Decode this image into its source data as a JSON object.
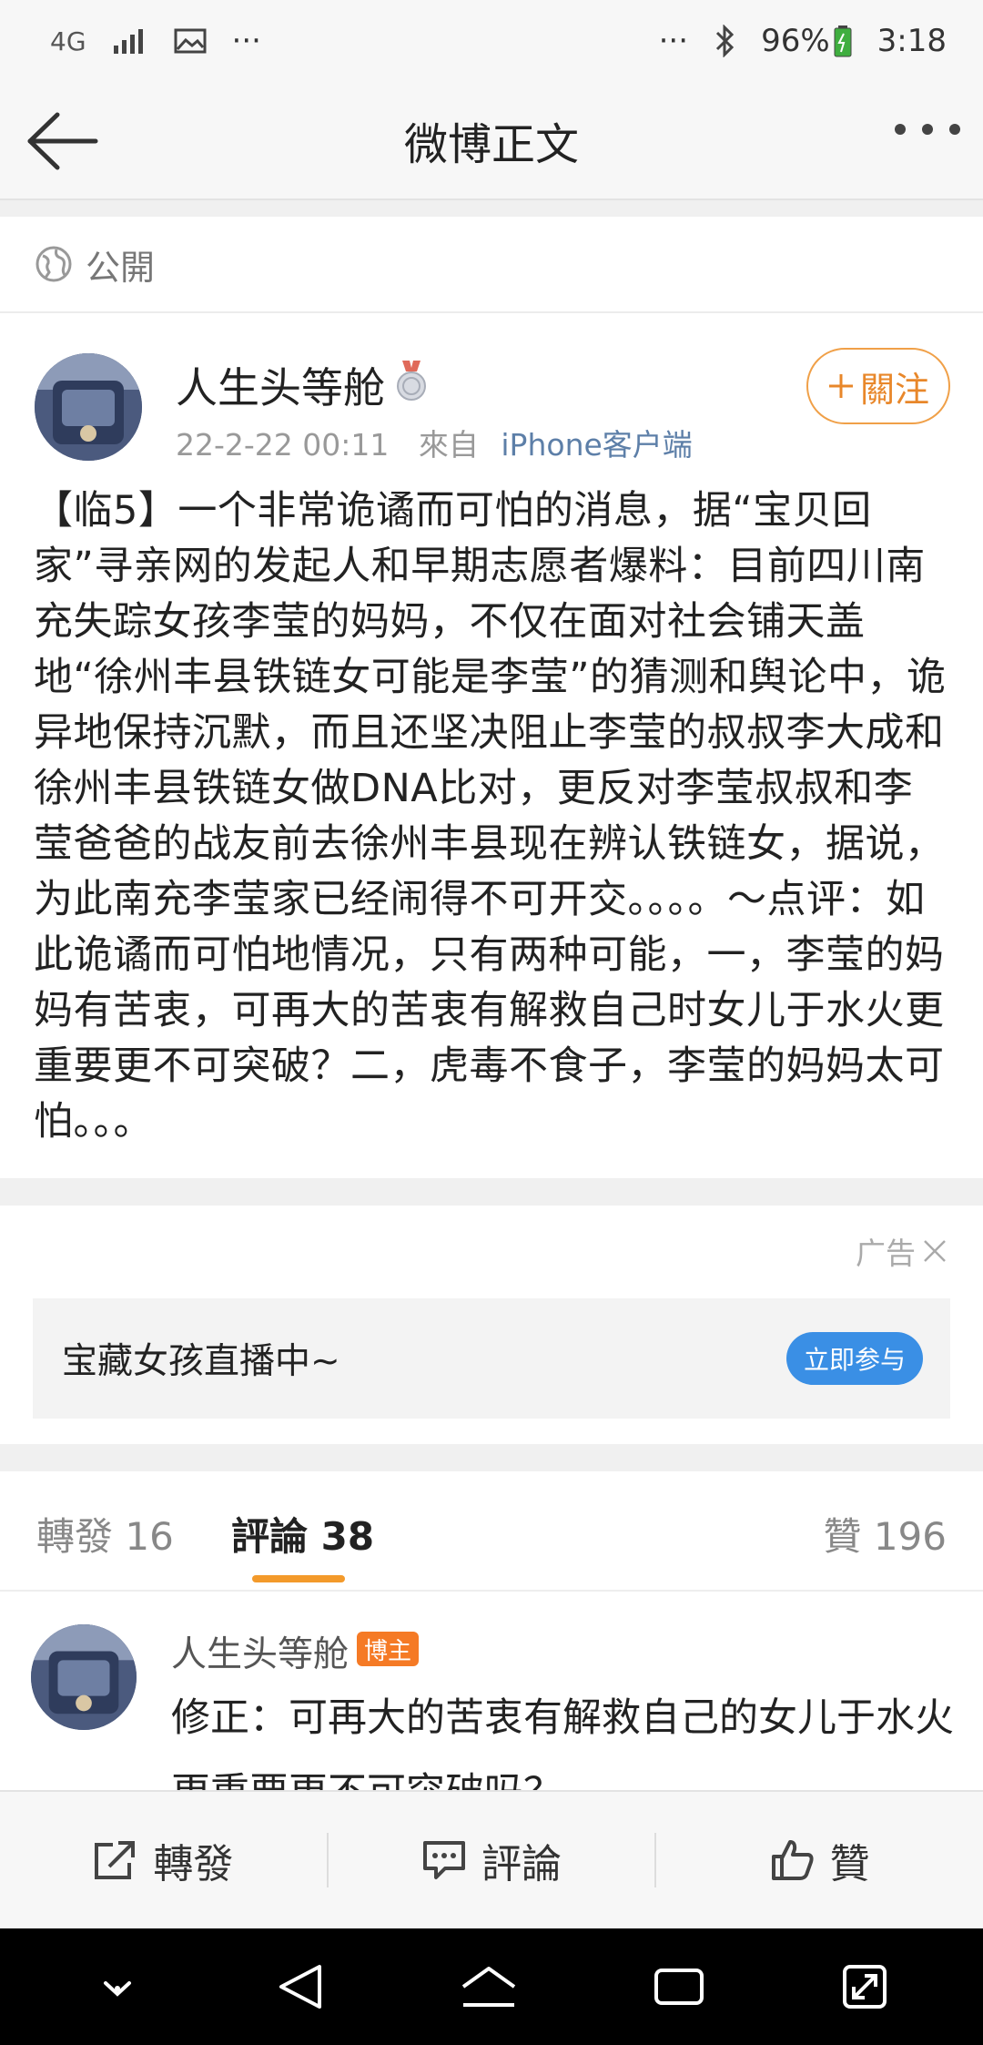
{
  "status_bar": {
    "network": "4G",
    "overflow_left": "···",
    "overflow_right": "···",
    "battery": "96%",
    "time": "3:18"
  },
  "nav": {
    "title": "微博正文",
    "back_icon": "arrow-left-icon",
    "more_icon": "more-dots-icon"
  },
  "visibility": {
    "label": "公開",
    "icon": "globe-icon"
  },
  "post": {
    "author": "人生头等舱",
    "time": "22-2-22 00:11",
    "from_prefix": "來自",
    "source": "iPhone客户端",
    "follow_label": "關注",
    "text": "【临5】一个非常诡谲而可怕的消息，据“宝贝回家”寻亲网的发起人和早期志愿者爆料：目前四川南充失踪女孩李莹的妈妈，不仅在面对社会铺天盖地“徐州丰县铁链女可能是李莹”的猜测和舆论中，诡异地保持沉默，而且还坚决阻止李莹的叔叔李大成和徐州丰县铁链女做DNA比对，更反对李莹叔叔和李莹爸爸的战友前去徐州丰县现在辨认铁链女，据说，为此南充李莹家已经闹得不可开交。。。。～点评：如此诡谲而可怕地情况，只有两种可能，一，李莹的妈妈有苦衷，可再大的苦衷有解救自己时女儿于水火更重要更不可突破？二，虎毒不食子，李莹的妈妈太可怕。。。"
  },
  "ad": {
    "label": "广告",
    "text": "宝藏女孩直播中~",
    "button": "立即参与"
  },
  "tabs": {
    "repost": "轉發 16",
    "comments": "評論 38",
    "likes": "贊 196"
  },
  "comment": {
    "author": "人生头等舱",
    "badge": "博主",
    "text": "修正：可再大的苦衷有解救自己的女儿于水火更重要更不可突破吗？"
  },
  "actions": {
    "repost": "轉發",
    "comment": "評論",
    "like": "贊"
  },
  "colors": {
    "accent_orange": "#f39a2b",
    "link_blue": "#5d7fa8",
    "ad_button_blue": "#3a8fe5",
    "badge_orange": "#f57a25"
  }
}
